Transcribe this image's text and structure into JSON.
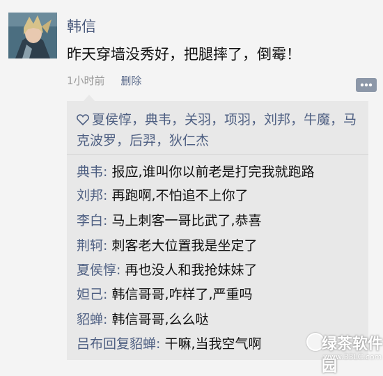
{
  "post": {
    "author": "韩信",
    "text": "昨天穿墙没秀好，把腿摔了，倒霉！",
    "time": "1小时前",
    "delete_label": "删除"
  },
  "likes": {
    "names": "夏侯惇，典韦，关羽，项羽，刘邦，牛魔，马克波罗，后羿，狄仁杰"
  },
  "comments": [
    {
      "author": "典韦",
      "text": "报应,谁叫你以前老是打完我就跑路"
    },
    {
      "author": "刘邦",
      "text": "再跑啊,不怕追不上你了"
    },
    {
      "author": "李白",
      "text": "马上刺客一哥比武了,恭喜"
    },
    {
      "author": "荆轲",
      "text": "刺客老大位置我是坐定了"
    },
    {
      "author": "夏侯惇",
      "text": "再也没人和我抢妹妹了"
    },
    {
      "author": "妲己",
      "text": "韩信哥哥,咋样了,严重吗"
    },
    {
      "author": "貂蝉",
      "text": "韩信哥哥,么么哒"
    },
    {
      "author": "吕布回复貂蝉",
      "text": "干嘛,当我空气啊"
    }
  ],
  "watermark": {
    "text": "绿茶软件园",
    "url": "www.33LC.com"
  },
  "icons": {
    "like": "heart-outline-icon",
    "more": "more-dots-icon",
    "avatar": "avatar-hero-image"
  }
}
